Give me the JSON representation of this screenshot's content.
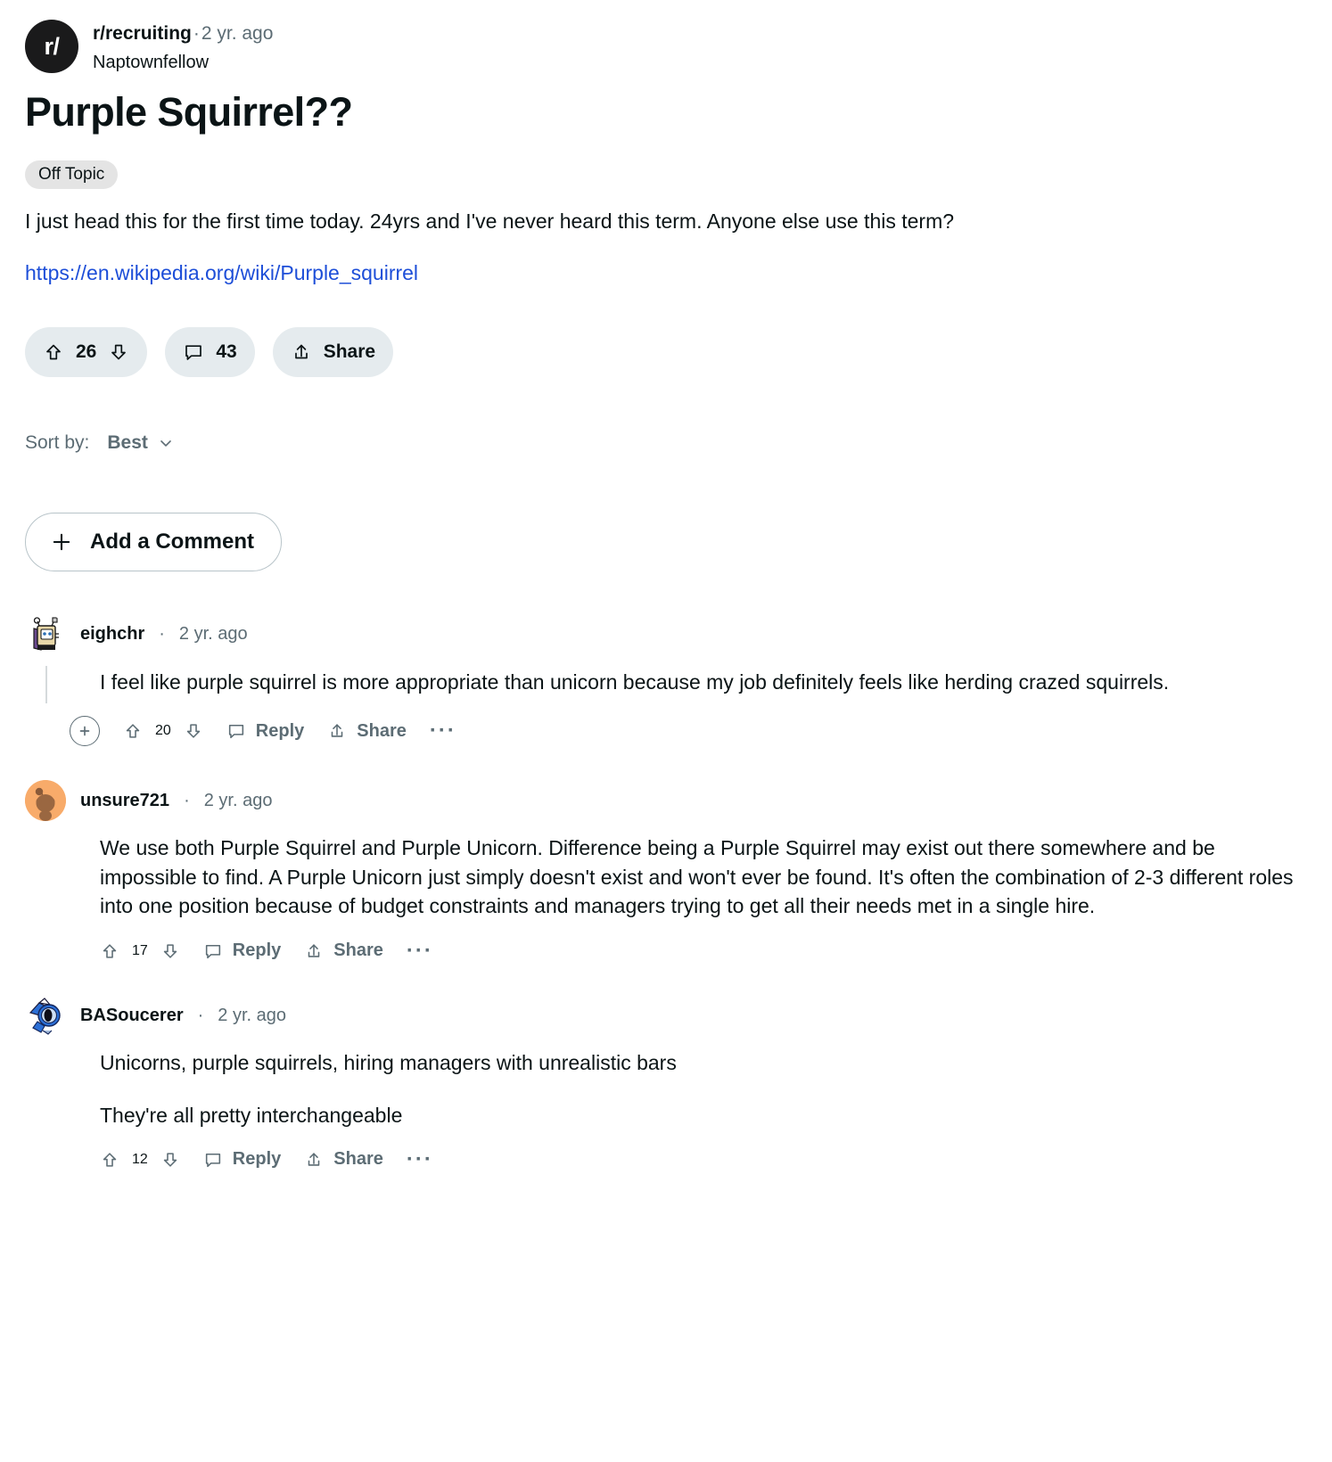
{
  "post": {
    "subreddit": "r/recruiting",
    "separator": "·",
    "age": "2 yr. ago",
    "author": "Naptownfellow",
    "subreddit_avatar_glyph": "r/",
    "title": "Purple Squirrel??",
    "flair": "Off Topic",
    "body": "I just head this for the first time today. 24yrs and I've never heard this term. Anyone else use this term?",
    "link": "https://en.wikipedia.org/wiki/Purple_squirrel",
    "actions": {
      "upvote_icon": "upvote-arrow-icon",
      "score": "26",
      "downvote_icon": "downvote-arrow-icon",
      "comment_icon": "comment-bubble-icon",
      "comment_count": "43",
      "share_icon": "share-icon",
      "share_label": "Share"
    }
  },
  "sort": {
    "label": "Sort by:",
    "value": "Best",
    "chevron_icon": "chevron-down-icon"
  },
  "add_comment": {
    "plus_icon": "plus-icon",
    "label": "Add a Comment"
  },
  "comment_actions_labels": {
    "reply": "Reply",
    "share": "Share",
    "more": "···"
  },
  "comments": [
    {
      "author": "eighchr",
      "separator": "·",
      "age": "2 yr. ago",
      "avatar_kind": "tv-robot-avatar",
      "avatar_bg": "#ffffff",
      "has_collapse": true,
      "score": "20",
      "paragraphs": [
        "I feel like purple squirrel is more appropriate than unicorn because my job definitely feels like herding crazed squirrels."
      ]
    },
    {
      "author": "unsure721",
      "separator": "·",
      "age": "2 yr. ago",
      "avatar_kind": "orange-snoo-avatar",
      "avatar_bg": "#f8ab6a",
      "has_collapse": false,
      "score": "17",
      "paragraphs": [
        "We use both Purple Squirrel and Purple Unicorn. Difference being a Purple Squirrel may exist out there somewhere and be impossible to find. A Purple Unicorn just simply doesn't exist and won't ever be found. It's often the combination of 2-3 different roles into one position because of budget constraints and managers trying to get all their needs met in a single hire."
      ]
    },
    {
      "author": "BASoucerer",
      "separator": "·",
      "age": "2 yr. ago",
      "avatar_kind": "blue-mech-avatar",
      "avatar_bg": "#ffffff",
      "has_collapse": false,
      "score": "12",
      "paragraphs": [
        "Unicorns, purple squirrels, hiring managers with unrealistic bars",
        "They're all pretty interchangeable"
      ]
    }
  ],
  "colors": {
    "link": "#1d4ed8",
    "muted": "#5c6c74",
    "pill_bg": "#e5ebee",
    "flair_bg": "#e4e4e4",
    "text": "#0b1416"
  }
}
